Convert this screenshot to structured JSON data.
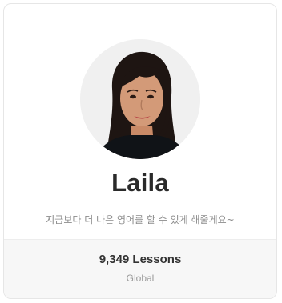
{
  "tutor": {
    "name": "Laila",
    "bio": "지금보다 더 나은 영어를 할 수 있게 해줄게요~",
    "lessons": "9,349 Lessons",
    "region": "Global",
    "avatar": "profile-photo"
  },
  "colors": {
    "card_border": "#e6e6e6",
    "footer_bg": "#f7f7f7",
    "name_text": "#2a2a2a",
    "muted_text": "#8c8c8c"
  }
}
